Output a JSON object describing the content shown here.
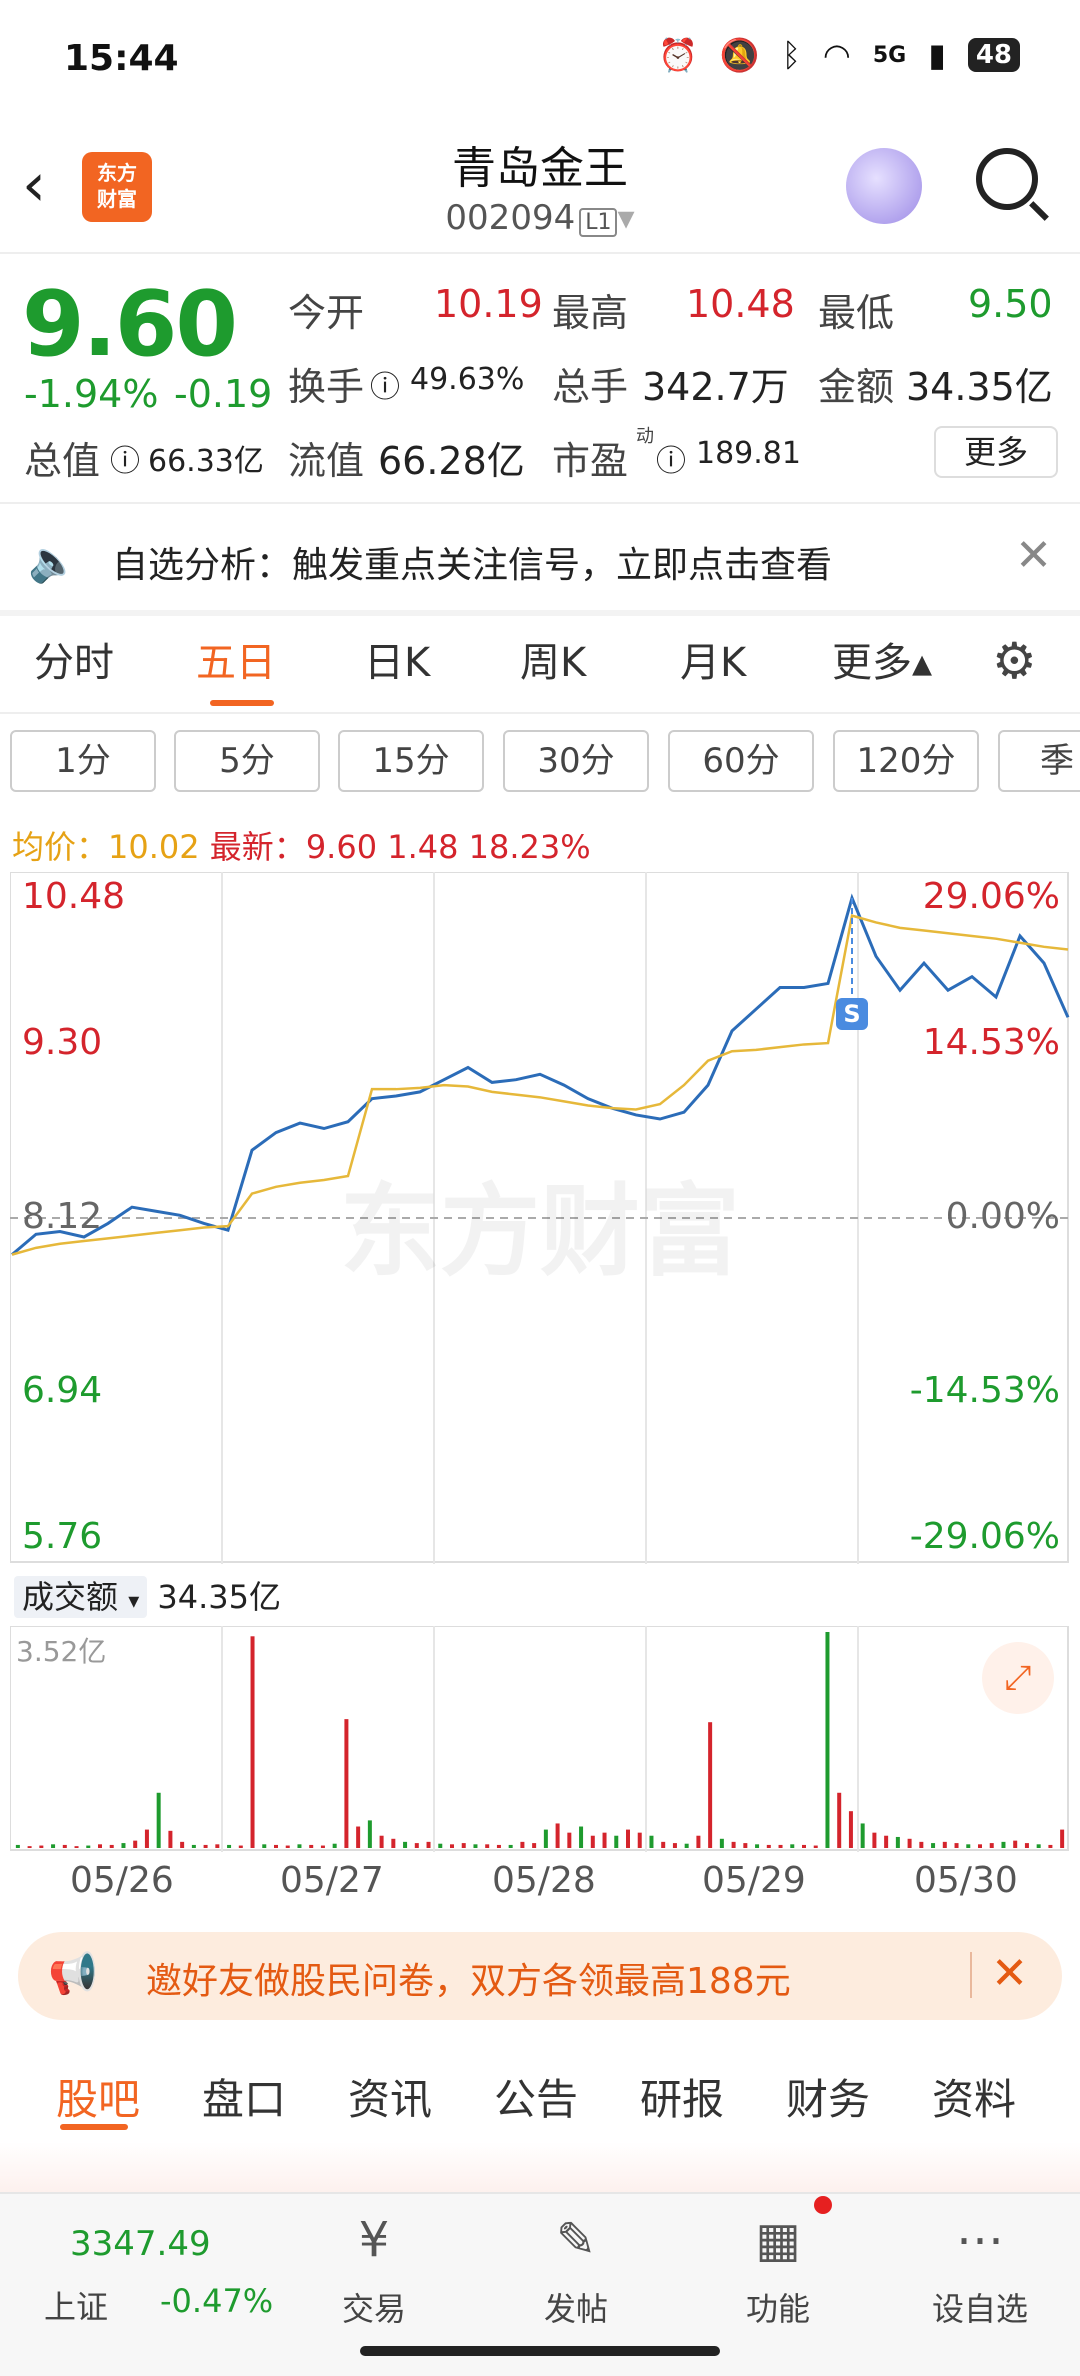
{
  "status_bar": {
    "time": "15:44",
    "network": "5G",
    "battery": "48"
  },
  "header": {
    "back": "‹",
    "logo_line1": "东方",
    "logo_line2": "财富",
    "stock_name": "青岛金王",
    "stock_code": "002094",
    "level": "L1",
    "dropdown": "▾"
  },
  "quote": {
    "price": "9.60",
    "change_pct": "-1.94%",
    "change_amt": "-0.19",
    "open_label": "今开",
    "open": "10.19",
    "high_label": "最高",
    "high": "10.48",
    "low_label": "最低",
    "low": "9.50",
    "turnover_label": "换手",
    "turnover": "49.63%",
    "volume_label": "总手",
    "volume": "342.7万",
    "amount_label": "金额",
    "amount": "34.35亿",
    "mktcap_label": "总值",
    "mktcap": "66.33亿",
    "float_label": "流值",
    "float_cap": "66.28亿",
    "pe_label": "市盈",
    "pe_sup": "动",
    "pe": "189.81",
    "more": "更多"
  },
  "alert": {
    "text": "自选分析：触发重点关注信号，立即点击查看"
  },
  "chart_tabs": {
    "tabs": [
      "分时",
      "五日",
      "日K",
      "周K",
      "月K",
      "更多▴"
    ],
    "active": "五日"
  },
  "periods": [
    "1分",
    "5分",
    "15分",
    "30分",
    "60分",
    "120分",
    "季"
  ],
  "stats": {
    "avg_label": "均价：",
    "avg": "10.02",
    "last_label": "最新：",
    "last": "9.60",
    "chg": "1.48",
    "pct": "18.23%"
  },
  "chart_data": {
    "type": "line",
    "title": "五日分时",
    "x": [
      "05/26",
      "05/27",
      "05/28",
      "05/29",
      "05/30"
    ],
    "ylim": [
      5.76,
      10.48
    ],
    "left_ticks": [
      "10.48",
      "9.30",
      "8.12",
      "6.94",
      "5.76"
    ],
    "right_ticks": [
      "29.06%",
      "14.53%",
      "0.00%",
      "-14.53%",
      "-29.06%"
    ],
    "series": [
      {
        "name": "价格",
        "color": "#2b6cb8",
        "values": [
          7.85,
          8.0,
          8.02,
          7.98,
          8.08,
          8.2,
          8.17,
          8.14,
          8.08,
          8.03,
          8.62,
          8.75,
          8.82,
          8.78,
          8.83,
          9.0,
          9.02,
          9.05,
          9.14,
          9.23,
          9.12,
          9.14,
          9.18,
          9.1,
          9.0,
          8.93,
          8.88,
          8.85,
          8.9,
          9.1,
          9.5,
          9.66,
          9.82,
          9.82,
          9.85,
          10.48,
          10.05,
          9.8,
          10.0,
          9.8,
          9.9,
          9.75,
          10.2,
          10.0,
          9.6
        ]
      },
      {
        "name": "均价",
        "color": "#e6b83a",
        "values": [
          7.85,
          7.9,
          7.93,
          7.95,
          7.97,
          7.99,
          8.01,
          8.03,
          8.05,
          8.06,
          8.3,
          8.35,
          8.38,
          8.4,
          8.43,
          9.07,
          9.07,
          9.08,
          9.1,
          9.09,
          9.05,
          9.03,
          9.01,
          8.98,
          8.95,
          8.93,
          8.92,
          8.96,
          9.1,
          9.28,
          9.35,
          9.36,
          9.38,
          9.4,
          9.41,
          10.35,
          10.3,
          10.26,
          10.24,
          10.22,
          10.2,
          10.18,
          10.15,
          10.12,
          10.1
        ]
      }
    ],
    "baseline": "8.12",
    "marker": "S"
  },
  "volume": {
    "label": "成交额",
    "dropdown": "▾",
    "total": "34.35亿",
    "max_label": "3.52亿",
    "values": [
      0.05,
      0.03,
      0.04,
      0.06,
      0.05,
      0.03,
      0.04,
      0.06,
      0.05,
      0.08,
      0.12,
      0.3,
      0.9,
      0.28,
      0.1,
      0.05,
      0.05,
      0.06,
      0.05,
      0.04,
      3.45,
      0.06,
      0.05,
      0.04,
      0.06,
      0.05,
      0.04,
      0.07,
      2.1,
      0.35,
      0.45,
      0.2,
      0.15,
      0.1,
      0.08,
      0.1,
      0.07,
      0.06,
      0.08,
      0.06,
      0.06,
      0.05,
      0.05,
      0.1,
      0.08,
      0.3,
      0.4,
      0.25,
      0.35,
      0.2,
      0.25,
      0.2,
      0.3,
      0.25,
      0.2,
      0.1,
      0.08,
      0.07,
      0.2,
      2.05,
      0.15,
      0.1,
      0.08,
      0.06,
      0.05,
      0.05,
      0.06,
      0.05,
      0.04,
      3.52,
      0.9,
      0.6,
      0.4,
      0.25,
      0.2,
      0.18,
      0.15,
      0.1,
      0.08,
      0.1,
      0.08,
      0.06,
      0.06,
      0.08,
      0.1,
      0.12,
      0.08,
      0.06,
      0.05,
      0.3
    ]
  },
  "dates": [
    "05/26",
    "05/27",
    "05/28",
    "05/29",
    "05/30"
  ],
  "promo": {
    "text": "邀好友做股民问卷，双方各领最高188元"
  },
  "bottom_tabs": {
    "tabs": [
      "股吧",
      "盘口",
      "资讯",
      "公告",
      "研报",
      "财务",
      "资料"
    ],
    "active": "股吧"
  },
  "nav": {
    "index_value": "3347.49",
    "index_name": "上证",
    "index_chg": "-0.47%",
    "items": [
      {
        "label": "交易",
        "icon": "trade-icon"
      },
      {
        "label": "发帖",
        "icon": "post-icon"
      },
      {
        "label": "功能",
        "icon": "grid-icon"
      },
      {
        "label": "设自选",
        "icon": "more-icon"
      }
    ]
  },
  "colors": {
    "up": "#d4242c",
    "down": "#1e9b2e",
    "accent": "#f26522",
    "price_line": "#2b6cb8",
    "avg_line": "#e6b83a"
  }
}
